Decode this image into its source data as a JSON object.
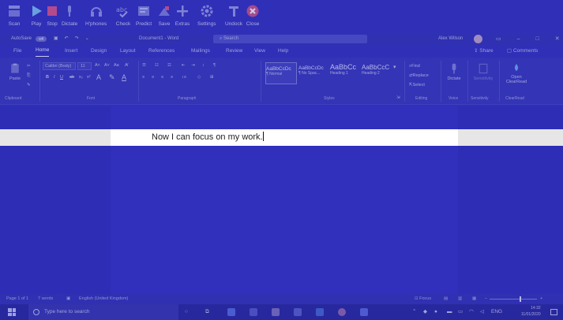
{
  "toolbar": {
    "buttons": [
      {
        "label": "Scan"
      },
      {
        "label": "Play"
      },
      {
        "label": "Stop"
      },
      {
        "label": "Dictate"
      },
      {
        "label": "H'phones"
      },
      {
        "label": "Check"
      },
      {
        "label": "Predict"
      },
      {
        "label": "Save"
      },
      {
        "label": "Extras"
      },
      {
        "label": "Settings"
      },
      {
        "label": "Undock"
      },
      {
        "label": "Close"
      }
    ]
  },
  "titlebar": {
    "autosave": "AutoSave",
    "autosave_state": "Off",
    "doc_title": "Document1 - Word",
    "search_placeholder": "Search",
    "user": "Alex Wilson"
  },
  "ribbon_tabs": [
    "File",
    "Home",
    "Insert",
    "Design",
    "Layout",
    "References",
    "Mailings",
    "Review",
    "View",
    "Help"
  ],
  "ribbon_actions": {
    "share": "Share",
    "comments": "Comments"
  },
  "ribbon": {
    "paste": "Paste",
    "font_name": "Calibri (Body)",
    "font_size": "11",
    "styles": [
      {
        "sample": "AaBbCcDc",
        "name": "¶ Normal"
      },
      {
        "sample": "AaBbCcDc",
        "name": "¶ No Spac..."
      },
      {
        "sample": "AaBbCc",
        "name": "Heading 1"
      },
      {
        "sample": "AaBbCcC",
        "name": "Heading 2"
      }
    ],
    "find": "Find",
    "replace": "Replace",
    "select": "Select",
    "dictate": "Dictate",
    "sensitivity": "Sensitivity",
    "open_clearread": "Open ClearRead",
    "groups": {
      "clipboard": "Clipboard",
      "font": "Font",
      "paragraph": "Paragraph",
      "styles": "Styles",
      "editing": "Editing",
      "voice": "Voice",
      "sensitivity": "Sensitivity",
      "clearread": "ClearRead"
    }
  },
  "document": {
    "focus_line": "Now I can focus on my work."
  },
  "statusbar": {
    "page": "Page 1 of 1",
    "words": "7 words",
    "language": "English (United Kingdom)",
    "focus": "Focus"
  },
  "taskbar": {
    "search_placeholder": "Type here to search",
    "language": "ENG",
    "time": "14:32",
    "date": "11/01/2020"
  },
  "colors": {
    "overlay": "#2f2fb8",
    "focus_band": "#e6e6e6",
    "page_focus": "#ffffff",
    "text": "#222222"
  }
}
